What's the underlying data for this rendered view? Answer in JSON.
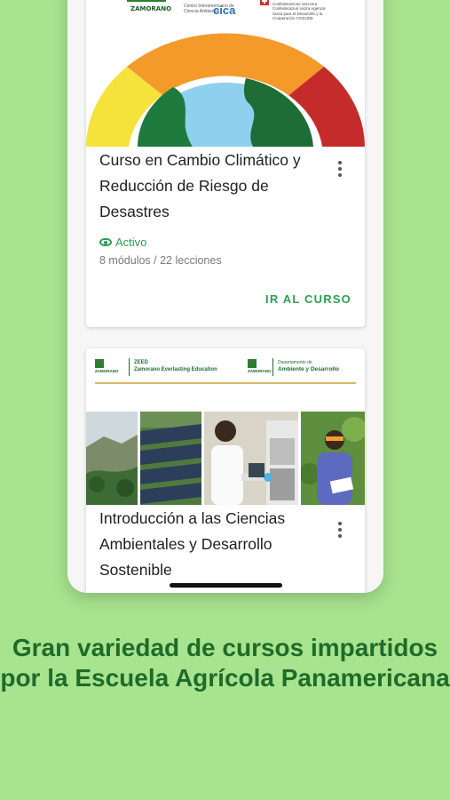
{
  "courses": [
    {
      "title": "Curso en Cambio Climático y Reducción de Riesgo de Desastres",
      "status": "Activo",
      "meta": "8 módulos / 22 lecciones",
      "action": "IR AL CURSO",
      "banner": {
        "org1": "ZAMORANO",
        "org2_small": "Centro Interamericano de Ciencia Ambiental",
        "org2": "cica",
        "org3": "Confederación Suiza Confederazione Svizzera Confederaziun svizra Agencia Suiza para el Desarrollo y la Cooperación COSUDE"
      }
    },
    {
      "title": "Introducción a las Ciencias Ambientales y Desarrollo Sostenible",
      "banner": {
        "org1": "ZAMORANO",
        "zeed_title": "ZEED",
        "zeed_sub": "Zamorano Everlasting Education",
        "dept_title": "Departamento de",
        "dept_sub": "Ambiente y Desarrollo"
      }
    }
  ],
  "caption": "Gran variedad de cursos impartidos por la Escuela Agrícola Panamericana",
  "colors": {
    "background": "#a8e38e",
    "accent": "#2e9e56",
    "caption": "#1e6b2a"
  }
}
